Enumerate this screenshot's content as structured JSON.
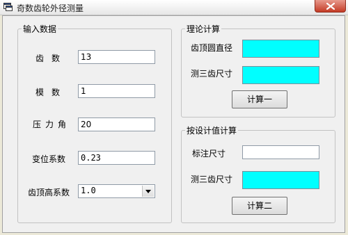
{
  "window": {
    "title": "奇数齿轮外径测量"
  },
  "input_group": {
    "title": "输入数据",
    "teeth": {
      "label": "齿数",
      "value": "13"
    },
    "module": {
      "label": "模数",
      "value": "1"
    },
    "pressure_angle": {
      "label": "压力角",
      "value": "20"
    },
    "shift_coef": {
      "label": "变位系数",
      "value": "0.23"
    },
    "addendum_coef": {
      "label": "齿顶高系数",
      "selected": "1.0"
    }
  },
  "theory_group": {
    "title": "理论计算",
    "tip_diameter_label": "齿顶圆直径",
    "three_tooth_label": "测三齿尺寸",
    "button": "计算一"
  },
  "design_group": {
    "title": "按设计值计算",
    "nominal_label": "标注尺寸",
    "three_tooth_label": "测三齿尺寸",
    "button": "计算二"
  },
  "colors": {
    "result_box": "#00ffff",
    "close_button": "#c43c26"
  },
  "icons": {
    "app": "window-app-icon",
    "close": "close-icon",
    "dropdown": "chevron-down-icon"
  }
}
